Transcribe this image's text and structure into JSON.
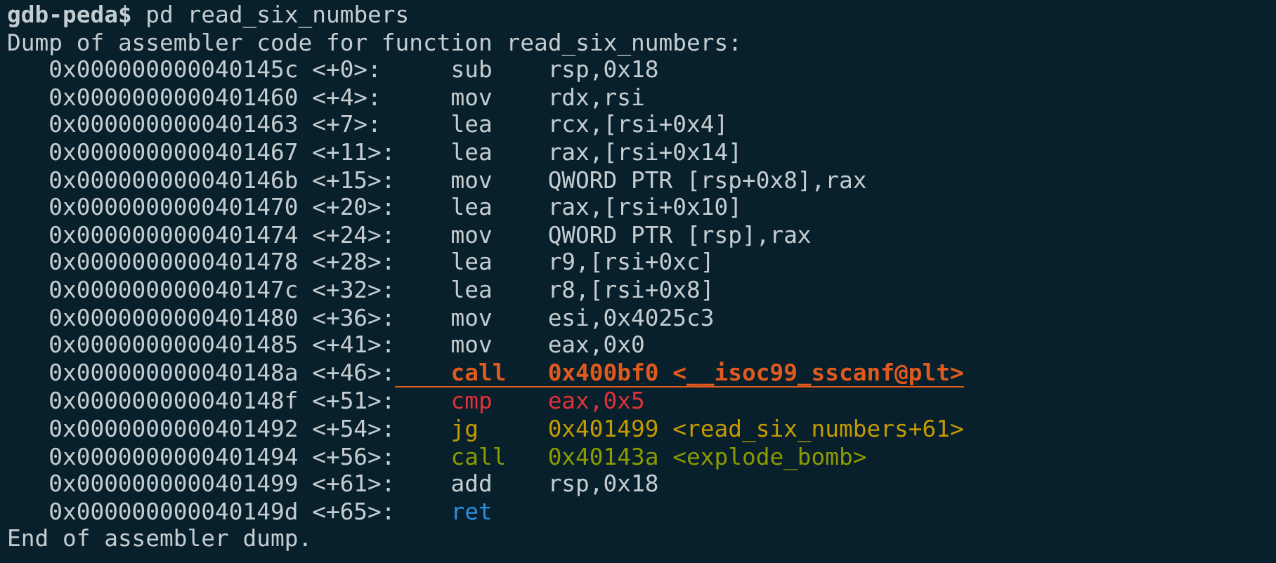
{
  "prompt": {
    "label": "gdb-peda$",
    "command": "pd read_six_numbers"
  },
  "header": "Dump of assembler code for function read_six_numbers:",
  "instructions": [
    {
      "address": "0x000000000040145c",
      "offset": "<+0>:",
      "mnemonic": "sub",
      "operands": "rsp,0x18",
      "kind": "plain",
      "current": false
    },
    {
      "address": "0x0000000000401460",
      "offset": "<+4>:",
      "mnemonic": "mov",
      "operands": "rdx,rsi",
      "kind": "plain",
      "current": false
    },
    {
      "address": "0x0000000000401463",
      "offset": "<+7>:",
      "mnemonic": "lea",
      "operands": "rcx,[rsi+0x4]",
      "kind": "plain",
      "current": false
    },
    {
      "address": "0x0000000000401467",
      "offset": "<+11>:",
      "mnemonic": "lea",
      "operands": "rax,[rsi+0x14]",
      "kind": "plain",
      "current": false
    },
    {
      "address": "0x000000000040146b",
      "offset": "<+15>:",
      "mnemonic": "mov",
      "operands": "QWORD PTR [rsp+0x8],rax",
      "kind": "plain",
      "current": false
    },
    {
      "address": "0x0000000000401470",
      "offset": "<+20>:",
      "mnemonic": "lea",
      "operands": "rax,[rsi+0x10]",
      "kind": "plain",
      "current": false
    },
    {
      "address": "0x0000000000401474",
      "offset": "<+24>:",
      "mnemonic": "mov",
      "operands": "QWORD PTR [rsp],rax",
      "kind": "plain",
      "current": false
    },
    {
      "address": "0x0000000000401478",
      "offset": "<+28>:",
      "mnemonic": "lea",
      "operands": "r9,[rsi+0xc]",
      "kind": "plain",
      "current": false
    },
    {
      "address": "0x000000000040147c",
      "offset": "<+32>:",
      "mnemonic": "lea",
      "operands": "r8,[rsi+0x8]",
      "kind": "plain",
      "current": false
    },
    {
      "address": "0x0000000000401480",
      "offset": "<+36>:",
      "mnemonic": "mov",
      "operands": "esi,0x4025c3",
      "kind": "plain",
      "current": false
    },
    {
      "address": "0x0000000000401485",
      "offset": "<+41>:",
      "mnemonic": "mov",
      "operands": "eax,0x0",
      "kind": "plain",
      "current": false
    },
    {
      "address": "0x000000000040148a",
      "offset": "<+46>:",
      "mnemonic": "call",
      "operands": "0x400bf0 <__isoc99_sscanf@plt>",
      "kind": "call",
      "current": true
    },
    {
      "address": "0x000000000040148f",
      "offset": "<+51>:",
      "mnemonic": "cmp",
      "operands": "eax,0x5",
      "kind": "compare",
      "current": false
    },
    {
      "address": "0x0000000000401492",
      "offset": "<+54>:",
      "mnemonic": "jg",
      "operands": "0x401499 <read_six_numbers+61>",
      "kind": "jump",
      "current": false
    },
    {
      "address": "0x0000000000401494",
      "offset": "<+56>:",
      "mnemonic": "call",
      "operands": "0x40143a <explode_bomb>",
      "kind": "call",
      "current": false
    },
    {
      "address": "0x0000000000401499",
      "offset": "<+61>:",
      "mnemonic": "add",
      "operands": "rsp,0x18",
      "kind": "plain",
      "current": false
    },
    {
      "address": "0x000000000040149d",
      "offset": "<+65>:",
      "mnemonic": "ret",
      "kind": "ret",
      "current": false
    }
  ],
  "footer": "End of assembler dump."
}
